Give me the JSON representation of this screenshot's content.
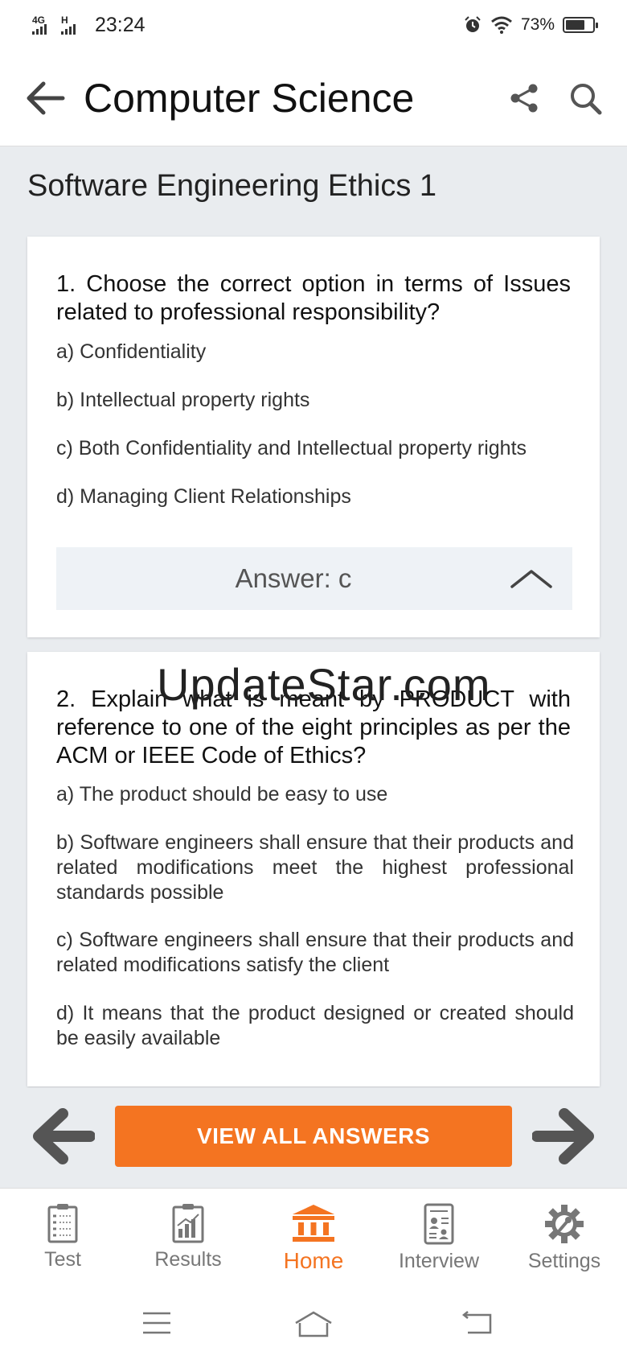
{
  "status": {
    "network1": "4G",
    "network2": "H",
    "time": "23:24",
    "battery_pct": "73%",
    "battery_level": 0.73
  },
  "appbar": {
    "title": "Computer Science",
    "back_icon": "arrow-left-icon",
    "share_icon": "share-icon",
    "search_icon": "search-icon"
  },
  "page": {
    "title": "Software Engineering Ethics 1"
  },
  "questions": [
    {
      "text": "1. Choose the correct option in terms of Issues related to professional responsibility?",
      "options": [
        "a) Confidentiality",
        "b) Intellectual property rights",
        "c) Both Confidentiality and Intellectual property rights",
        "d) Managing Client Relationships"
      ],
      "answer": "Answer: c"
    },
    {
      "text": "2. Explain what is meant by PRODUCT with reference to one of the eight principles as per the ACM or IEEE Code of Ethics?",
      "options": [
        "a) The product should be easy to use",
        "b) Software engineers shall ensure that their products and related modifications meet the highest professional standards possible",
        "c) Software engineers shall ensure that their products and related modifications satisfy the client",
        "d) It means that the product designed or created should be easily available"
      ]
    }
  ],
  "watermark": "UpdateStar.com",
  "actions": {
    "view_all": "VIEW ALL ANSWERS"
  },
  "tabs": [
    {
      "label": "Test",
      "icon": "checklist-icon"
    },
    {
      "label": "Results",
      "icon": "bar-chart-icon"
    },
    {
      "label": "Home",
      "icon": "institution-icon",
      "active": true
    },
    {
      "label": "Interview",
      "icon": "id-card-icon"
    },
    {
      "label": "Settings",
      "icon": "gear-icon"
    }
  ],
  "colors": {
    "accent": "#f47421",
    "background": "#e9ecef",
    "answer_bg": "#eef2f6"
  }
}
